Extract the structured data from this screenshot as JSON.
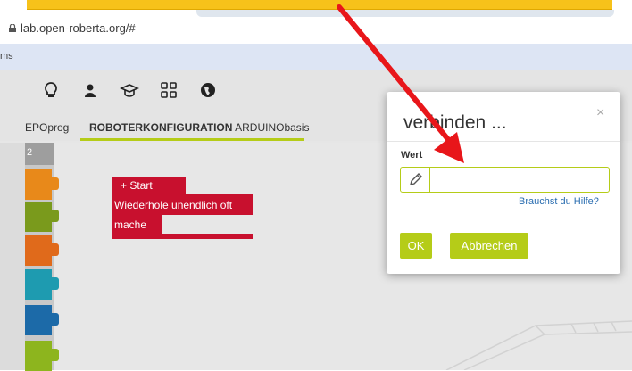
{
  "browser": {
    "url": "lab.open-roberta.org/#",
    "bookmarks_text": "ms"
  },
  "toolbar": {
    "icons": [
      "lightbulb-icon",
      "user-icon",
      "graduation-cap-icon",
      "grid-icon",
      "globe-icon"
    ]
  },
  "tabs": {
    "program_tab": "EPOprog",
    "config_tab_bold": "ROBOTERKONFIGURATION",
    "config_tab_name": " ARDUINObasis"
  },
  "toolbox": {
    "header": "2",
    "puzzle_colors": [
      "#e8891a",
      "#7a9a1c",
      "#e06a1b",
      "#1e9bb0",
      "#1c6aa8",
      "#8db51e"
    ]
  },
  "blocks": {
    "start_label": "+  Start",
    "repeat_label": "Wiederhole unendlich oft",
    "do_label": "mache",
    "color": "#c8102e"
  },
  "dialog": {
    "title": "verbinden ...",
    "close": "×",
    "field_label": "Wert",
    "input_value": "",
    "help_link": "Brauchst du Hilfe?",
    "ok_button": "OK",
    "cancel_button": "Abbrechen"
  },
  "colors": {
    "accent": "#b5cc18",
    "banner": "#f7c21a",
    "arrow": "#e8161a"
  }
}
